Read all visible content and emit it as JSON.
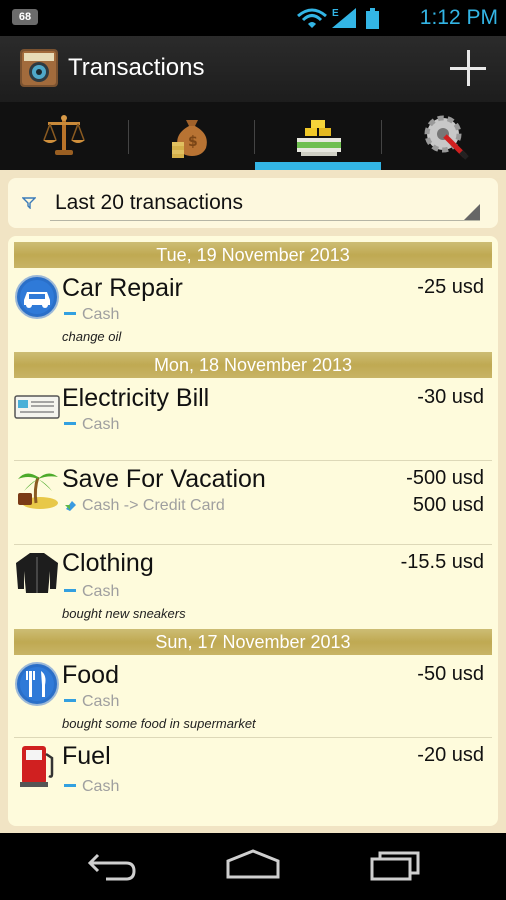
{
  "status_bar": {
    "notification_count": "68",
    "network_type": "E",
    "time": "1:12 PM",
    "icons": [
      "wifi-icon",
      "signal-icon",
      "battery-icon"
    ]
  },
  "action_bar": {
    "title": "Transactions",
    "app_icon": "wallet-icon",
    "add_icon": "plus-icon"
  },
  "tabs": [
    {
      "icon": "balance-scale-icon",
      "selected": false
    },
    {
      "icon": "money-bag-icon",
      "selected": false
    },
    {
      "icon": "transactions-icon",
      "selected": true
    },
    {
      "icon": "settings-gear-icon",
      "selected": false
    }
  ],
  "filter": {
    "icon": "filter-funnel-icon",
    "label": "Last 20 transactions"
  },
  "groups": [
    {
      "date": "Tue, 19 November 2013",
      "transactions": [
        {
          "name": "Car Repair",
          "account": "Cash",
          "note": "change oil",
          "amount": "-25 usd",
          "icon": "car-icon"
        }
      ]
    },
    {
      "date": "Mon, 18 November 2013",
      "transactions": [
        {
          "name": "Electricity Bill",
          "account": "Cash",
          "amount": "-30 usd",
          "icon": "bill-icon"
        },
        {
          "name": "Save For Vacation",
          "account": "Cash -> Credit Card",
          "amount": "-500 usd",
          "amount2": "500 usd",
          "icon": "palm-tree-icon",
          "transfer": true
        },
        {
          "name": "Clothing",
          "account": "Cash",
          "note": "bought new sneakers",
          "amount": "-15.5 usd",
          "icon": "jacket-icon"
        }
      ]
    },
    {
      "date": "Sun, 17 November 2013",
      "transactions": [
        {
          "name": "Food",
          "account": "Cash",
          "note": "bought some food in supermarket",
          "amount": "-50 usd",
          "icon": "fork-knife-icon"
        },
        {
          "name": "Fuel",
          "account": "Cash",
          "amount": "-20 usd",
          "icon": "fuel-pump-icon"
        }
      ]
    }
  ],
  "colors": {
    "accent": "#33b5e5",
    "date_header": "#c4ae5c",
    "list_background": "#fefbdc"
  }
}
